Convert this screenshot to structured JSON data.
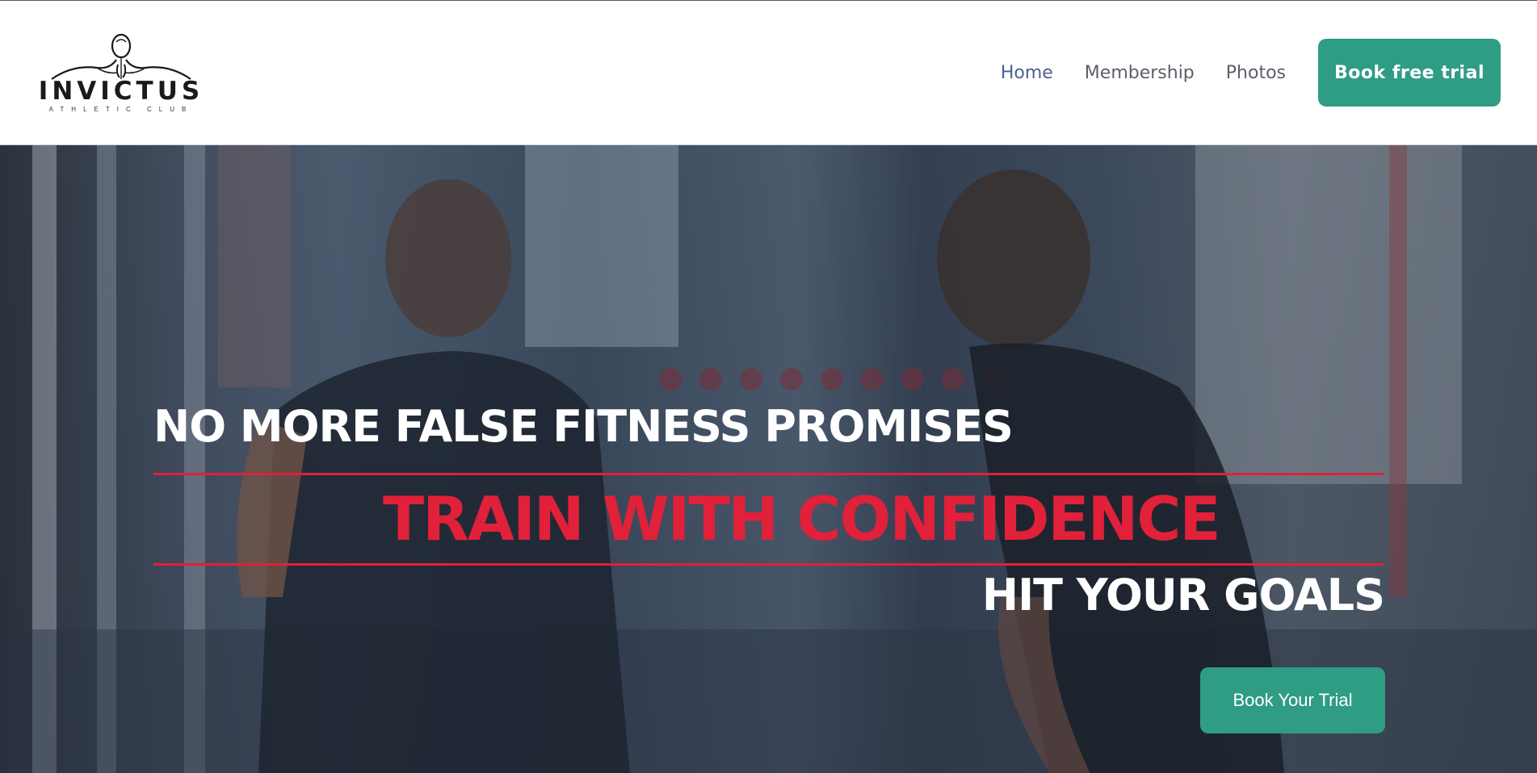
{
  "brand": {
    "name": "INVICTUS",
    "tagline": "ATHLETIC CLUB",
    "logo_icon": "athlete-silhouette-icon"
  },
  "nav": {
    "items": [
      {
        "label": "Home",
        "active": true
      },
      {
        "label": "Membership",
        "active": false
      },
      {
        "label": "Photos",
        "active": false
      }
    ],
    "cta_label": "Book free trial"
  },
  "hero": {
    "headline_top": "NO MORE FALSE FITNESS PROMISES",
    "headline_main": "TRAIN WITH CONFIDENCE",
    "headline_bottom": "HIT YOUR GOALS",
    "cta_label": "Book Your Trial"
  },
  "colors": {
    "accent_green": "#2f9c84",
    "accent_red": "#e1203a",
    "nav_active": "#4e5f92",
    "nav_text": "#5b6068"
  }
}
